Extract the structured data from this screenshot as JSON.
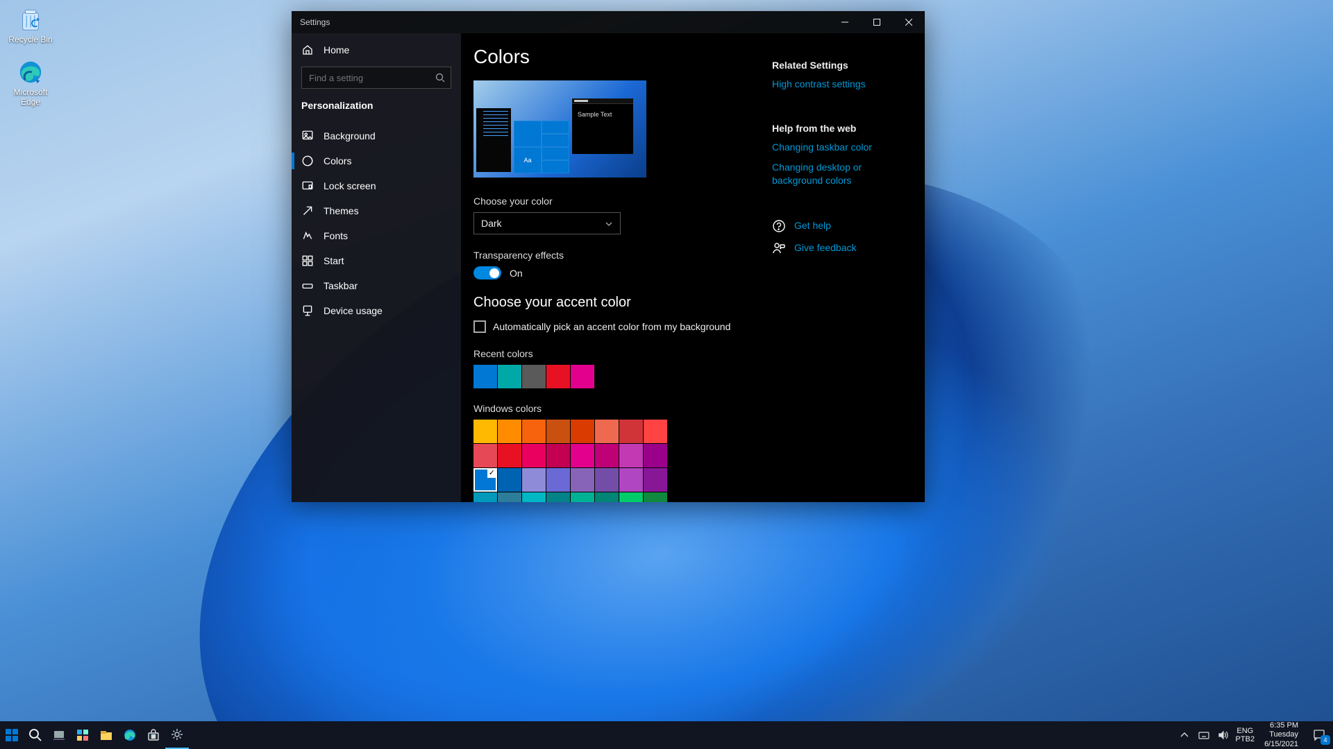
{
  "desktop": {
    "icons": [
      {
        "label": "Recycle Bin",
        "kind": "recycle"
      },
      {
        "label": "Microsoft Edge",
        "kind": "edge"
      }
    ]
  },
  "settings": {
    "window_title": "Settings",
    "home_label": "Home",
    "search_placeholder": "Find a setting",
    "category": "Personalization",
    "nav": [
      {
        "label": "Background",
        "selected": false
      },
      {
        "label": "Colors",
        "selected": true
      },
      {
        "label": "Lock screen",
        "selected": false
      },
      {
        "label": "Themes",
        "selected": false
      },
      {
        "label": "Fonts",
        "selected": false
      },
      {
        "label": "Start",
        "selected": false
      },
      {
        "label": "Taskbar",
        "selected": false
      },
      {
        "label": "Device usage",
        "selected": false
      }
    ],
    "page": {
      "title": "Colors",
      "preview_sample_text": "Sample Text",
      "preview_aa": "Aa",
      "choose_color_label": "Choose your color",
      "choose_color_value": "Dark",
      "transparency_label": "Transparency effects",
      "transparency_value": "On",
      "accent_heading": "Choose your accent color",
      "auto_pick_label": "Automatically pick an accent color from my background",
      "recent_label": "Recent colors",
      "recent_colors": [
        "#0078d4",
        "#00a8a8",
        "#5a5a5a",
        "#e81123",
        "#e3008c"
      ],
      "windows_label": "Windows colors",
      "windows_colors": [
        "#ffb900",
        "#ff8c00",
        "#f7630c",
        "#ca5010",
        "#da3b01",
        "#ef6950",
        "#d13438",
        "#ff4343",
        "#e74856",
        "#e81123",
        "#ea005e",
        "#c30052",
        "#e3008c",
        "#bf0077",
        "#c239b3",
        "#9a0089",
        "#0078d4",
        "#0063b1",
        "#8e8cd8",
        "#6b69d6",
        "#8764b8",
        "#744da9",
        "#b146c2",
        "#881798",
        "#0099bc",
        "#2d7d9a",
        "#00b7c3",
        "#038387",
        "#00b294",
        "#018574",
        "#00cc6a",
        "#10893e"
      ],
      "windows_selected_index": 16
    },
    "aside": {
      "related_heading": "Related Settings",
      "high_contrast": "High contrast settings",
      "help_heading": "Help from the web",
      "help_links": [
        "Changing taskbar color",
        "Changing desktop or background colors"
      ],
      "get_help": "Get help",
      "give_feedback": "Give feedback"
    }
  },
  "taskbar": {
    "lang_lines": [
      "ENG",
      "PTB2"
    ],
    "clock": {
      "time": "6:35 PM",
      "day": "Tuesday",
      "date": "6/15/2021"
    },
    "notif_count": "4"
  }
}
